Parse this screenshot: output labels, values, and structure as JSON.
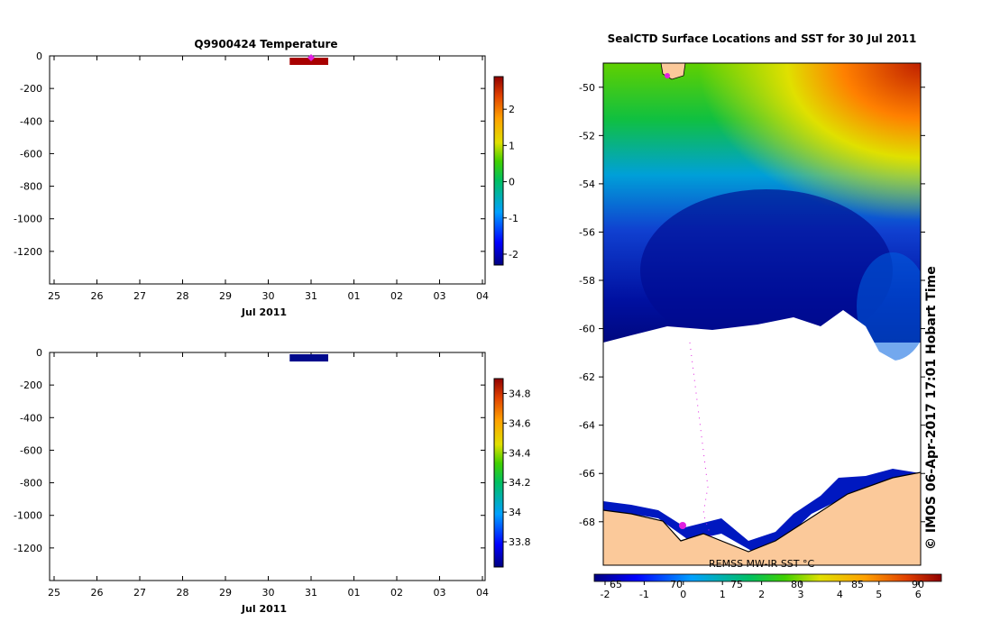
{
  "chart_data": [
    {
      "type": "heatmap",
      "title": "Q9900424  Temperature",
      "xlabel": "Jul 2011",
      "x_ticks": [
        "25",
        "26",
        "27",
        "28",
        "29",
        "30",
        "31",
        "01",
        "02",
        "03",
        "04"
      ],
      "ylim": [
        -1400,
        0
      ],
      "y_ticks": [
        0,
        -200,
        -400,
        -600,
        -800,
        -1000,
        -1200
      ],
      "profile": {
        "day_start": 30.5,
        "day_end": 31.4,
        "depth_min": 0,
        "depth_max": -55,
        "value": 2.8,
        "color": "#a80000"
      },
      "marker": {
        "day": 31.0,
        "depth": 0,
        "color": "#e020e0"
      },
      "colorbar": {
        "ticks": [
          2,
          1,
          0,
          -1,
          -2
        ],
        "range": [
          -2.3,
          2.9
        ]
      }
    },
    {
      "type": "heatmap",
      "title": "",
      "xlabel": "Jul 2011",
      "x_ticks": [
        "25",
        "26",
        "27",
        "28",
        "29",
        "30",
        "31",
        "01",
        "02",
        "03",
        "04"
      ],
      "ylim": [
        -1400,
        0
      ],
      "y_ticks": [
        0,
        -200,
        -400,
        -600,
        -800,
        -1000,
        -1200
      ],
      "profile": {
        "day_start": 30.5,
        "day_end": 31.4,
        "depth_min": 0,
        "depth_max": -55,
        "value": 33.65,
        "color": "#000a8c"
      },
      "colorbar": {
        "ticks": [
          34.8,
          34.6,
          34.4,
          34.2,
          34,
          33.8
        ],
        "range": [
          33.63,
          34.9
        ]
      }
    },
    {
      "type": "heatmap",
      "title": "SealCTD Surface Locations and SST for 30 Jul 2011",
      "y_ticks": [
        -50,
        -52,
        -54,
        -56,
        -58,
        -60,
        -62,
        -64,
        -66,
        -68
      ],
      "ylim": [
        -69.8,
        -49.0
      ],
      "x_ticks_top": [
        "65",
        "70",
        "75",
        "80",
        "85",
        "90"
      ],
      "colorbar_ticks": [
        "-2",
        "-1",
        "0",
        "1",
        "2",
        "3",
        "4",
        "5",
        "6"
      ],
      "colorbar_label": "REMSS MW-IR SST °C",
      "side_label": "© IMOS 06-Apr-2017 17:01 Hobart Time"
    }
  ]
}
